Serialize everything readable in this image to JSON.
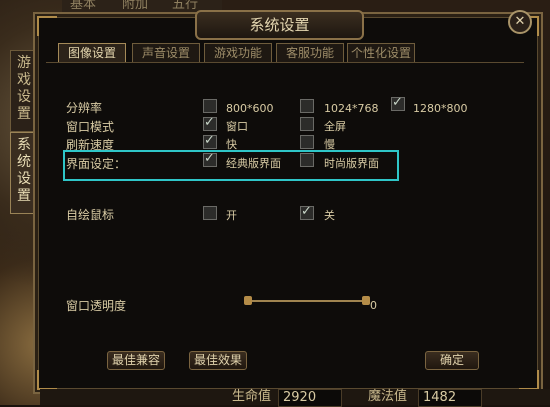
{
  "top_tabs": [
    "基本",
    "附加",
    "五行"
  ],
  "side_tabs": [
    {
      "label": "游戏设置"
    },
    {
      "label": "系统设置"
    }
  ],
  "title": "系统设置",
  "close_icon": "close-icon",
  "tabs": [
    {
      "label": "图像设置"
    },
    {
      "label": "声音设置"
    },
    {
      "label": "游戏功能"
    },
    {
      "label": "客服功能"
    },
    {
      "label": "个性化设置"
    }
  ],
  "settings": {
    "resolution": {
      "label": "分辨率",
      "options": [
        {
          "label": "800*600",
          "checked": false
        },
        {
          "label": "1024*768",
          "checked": false
        },
        {
          "label": "1280*800",
          "checked": true
        }
      ]
    },
    "window_mode": {
      "label": "窗口模式",
      "options": [
        {
          "label": "窗口",
          "checked": true
        },
        {
          "label": "全屏",
          "checked": false
        }
      ]
    },
    "refresh_rate": {
      "label": "刷新速度",
      "options": [
        {
          "label": "快",
          "checked": true
        },
        {
          "label": "慢",
          "checked": false
        }
      ]
    },
    "ui_style": {
      "label": "界面设定：",
      "options": [
        {
          "label": "经典版界面",
          "checked": true
        },
        {
          "label": "时尚版界面",
          "checked": false
        }
      ]
    },
    "custom_cursor": {
      "label": "自绘鼠标",
      "options": [
        {
          "label": "开",
          "checked": false
        },
        {
          "label": "关",
          "checked": true
        }
      ]
    },
    "window_opacity": {
      "label": "窗口透明度",
      "value": "0"
    }
  },
  "buttons": {
    "best_compat": "最佳兼容",
    "best_effect": "最佳效果",
    "ok": "确定"
  },
  "status_bar": {
    "hp_label": "生命值",
    "hp_value": "2920",
    "mp_label": "魔法值",
    "mp_value": "1482"
  },
  "colors": {
    "highlight": "#2fc6c8",
    "accent": "#b08c4a"
  }
}
